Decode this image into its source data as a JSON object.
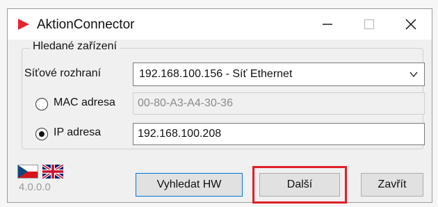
{
  "window": {
    "title": "AktionConnector",
    "controls": {
      "minimize_icon": "minimize-icon",
      "maximize_icon": "maximize-icon",
      "close_icon": "close-icon"
    }
  },
  "group": {
    "label": "Hledané zařízení",
    "network_interface": {
      "label": "Síťové rozhraní",
      "selected": "192.168.100.156 - Síť Ethernet"
    },
    "mac": {
      "label": "MAC adresa",
      "value": "00-80-A3-A4-30-36",
      "selected": false
    },
    "ip": {
      "label": "IP adresa",
      "value": "192.168.100.208",
      "selected": true
    }
  },
  "footer": {
    "version": "4.0.0.0",
    "buttons": {
      "search_hw": "Vyhledat HW",
      "next": "Další",
      "close": "Zavřít"
    }
  },
  "colors": {
    "highlight": "#e01f2a",
    "accent_border": "#0078d7",
    "app_icon": "#e3262b"
  }
}
